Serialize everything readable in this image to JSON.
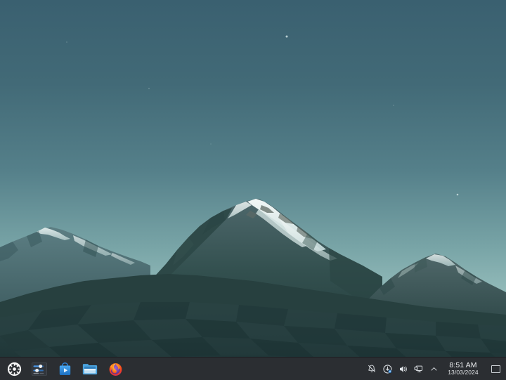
{
  "desktop": {
    "wallpaper": {
      "name": "mountain-landscape-wallpaper",
      "description": "Low-poly snow-capped mountain range at dusk",
      "sky_top_color": "#3c6271",
      "sky_horizon_color": "#a9cbc7",
      "ridge_color": "#3f5c60",
      "foreground_color": "#233b3d",
      "snow_color": "#e6efee"
    },
    "icons": []
  },
  "taskbar": {
    "background_color": "#2b2e32",
    "launchers": [
      {
        "name": "application-launcher",
        "label": "Application Launcher",
        "icon": "kubuntu-logo-icon"
      },
      {
        "name": "system-settings",
        "label": "System Settings",
        "icon": "sliders-icon"
      },
      {
        "name": "discover",
        "label": "Discover",
        "icon": "shopping-bag-icon"
      },
      {
        "name": "dolphin",
        "label": "Dolphin File Manager",
        "icon": "folder-icon"
      },
      {
        "name": "firefox",
        "label": "Firefox Web Browser",
        "icon": "firefox-icon"
      }
    ],
    "tray": [
      {
        "name": "notifications",
        "label": "Notifications",
        "icon": "bell-slash-icon"
      },
      {
        "name": "updates",
        "label": "Updates",
        "icon": "update-icon"
      },
      {
        "name": "volume",
        "label": "Volume",
        "icon": "speaker-icon"
      },
      {
        "name": "display",
        "label": "Display Configuration",
        "icon": "monitor-icon"
      },
      {
        "name": "show-hidden",
        "label": "Show hidden icons",
        "icon": "chevron-up-icon"
      }
    ],
    "clock": {
      "time": "8:51 AM",
      "date": "13/03/2024"
    },
    "show_desktop": {
      "label": "Peek at Desktop",
      "icon": "square-outline-icon"
    }
  }
}
